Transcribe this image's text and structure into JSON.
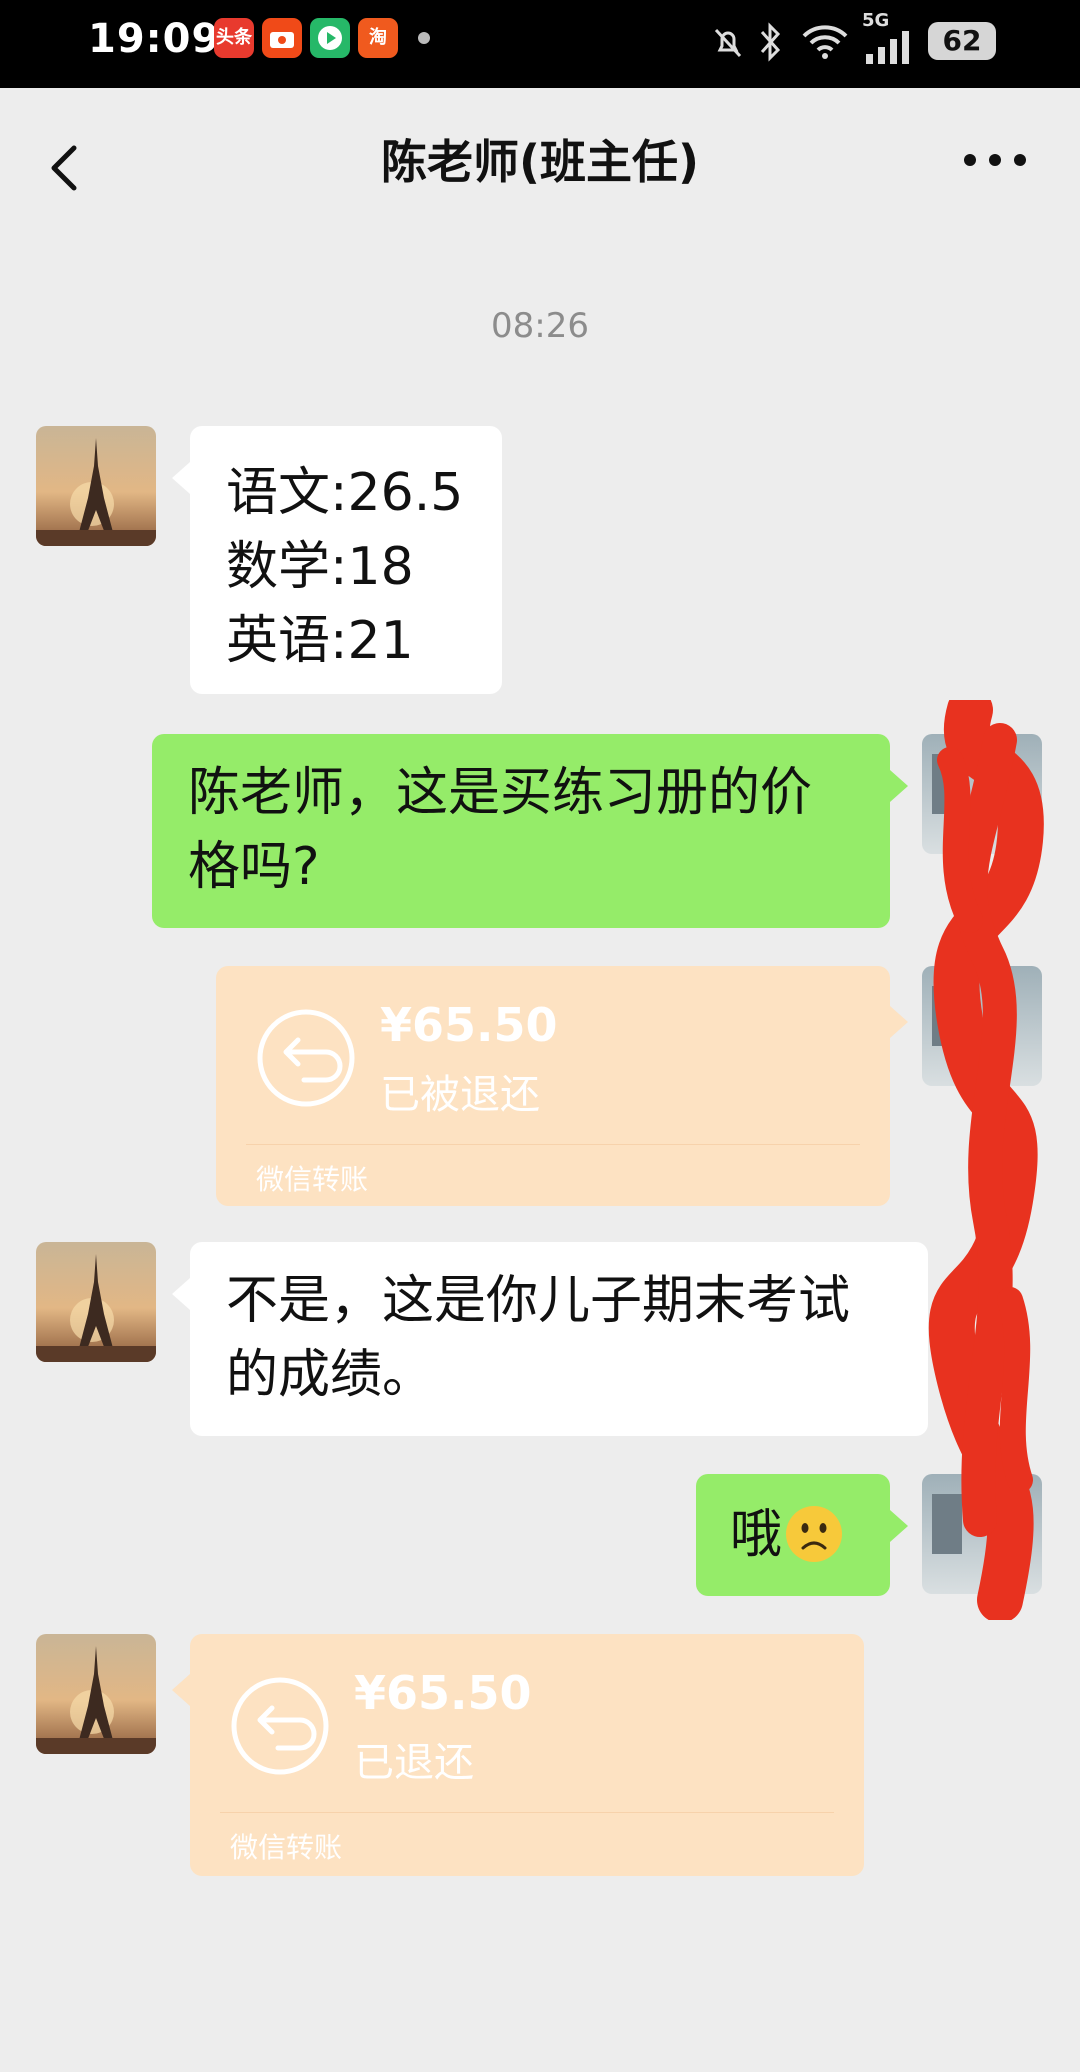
{
  "status_bar": {
    "time": "19:09",
    "apps": [
      {
        "label": "头条",
        "color": "#e83a2e"
      },
      {
        "label": "",
        "color": "#f04a18"
      },
      {
        "label": "",
        "color": "#26b868"
      },
      {
        "label": "淘",
        "color": "#f05a1e"
      }
    ],
    "network": "5G",
    "battery": "62"
  },
  "header": {
    "title": "陈老师(班主任)"
  },
  "chat": {
    "timestamp": "08:26",
    "messages": [
      {
        "side": "left",
        "type": "text",
        "lines": [
          "语文:26.5",
          "数学:18",
          "英语:21"
        ]
      },
      {
        "side": "right",
        "type": "text",
        "lines": [
          "陈老师，这是买练习册的价",
          "格吗?"
        ]
      },
      {
        "side": "right",
        "type": "transfer",
        "amount": "¥65.50",
        "status": "已被退还",
        "footer": "微信转账"
      },
      {
        "side": "left",
        "type": "text",
        "lines": [
          "不是，这是你儿子期末考试",
          "的成绩。"
        ]
      },
      {
        "side": "right",
        "type": "text",
        "text": "哦",
        "emoji": "frowning-face"
      },
      {
        "side": "left",
        "type": "transfer",
        "amount": "¥65.50",
        "status": "已退还",
        "footer": "微信转账"
      }
    ]
  },
  "colors": {
    "background": "#ededed",
    "green_bubble": "#95ec69",
    "transfer_bg": "#fde2c2",
    "redaction": "#e8321f"
  }
}
